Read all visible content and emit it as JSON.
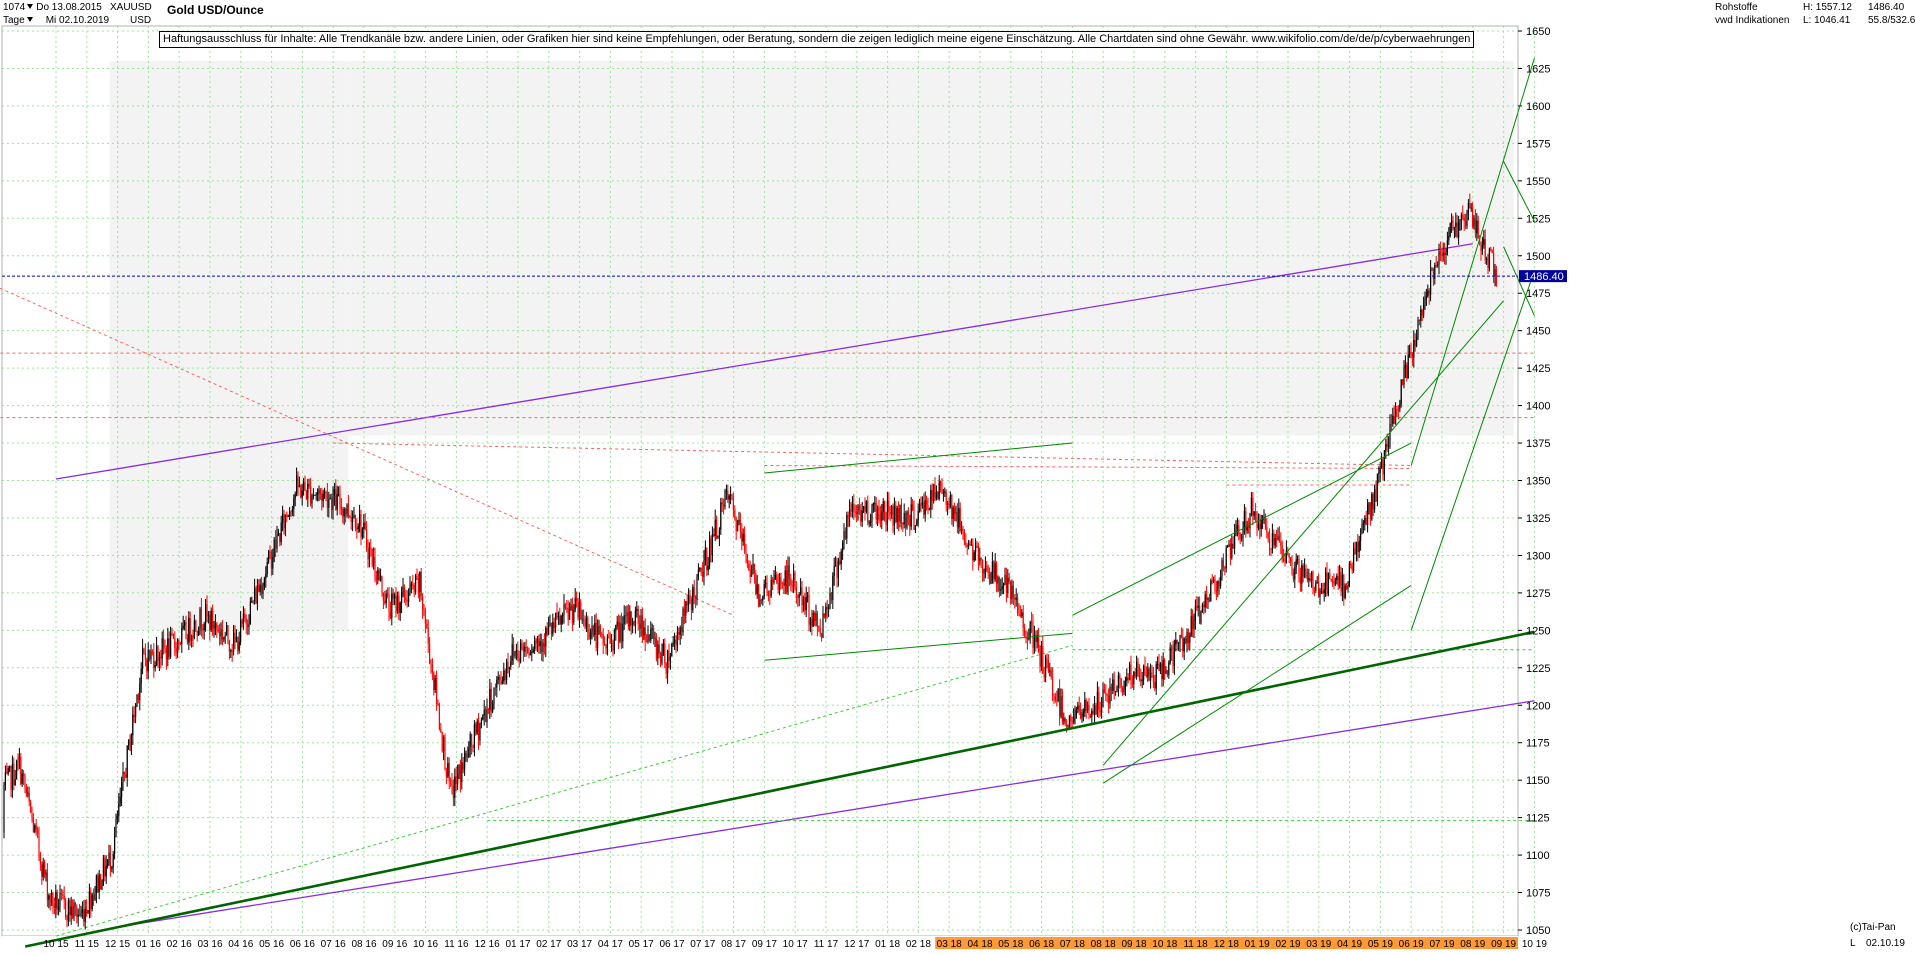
{
  "header": {
    "bar_count": "1074",
    "start_date": "Do 13.08.2015",
    "symbol": "XAUUSD",
    "period": "Tage",
    "end_date": "Mi 02.10.2019",
    "currency": "USD",
    "title": "Gold USD/Ounce",
    "category": "Rohstoffe",
    "source": "vwd Indikationen",
    "high_label": "H: 1557.12",
    "low_label": "L: 1046.41",
    "last_value": "1486.40",
    "range_value": "55.8/532.6",
    "copyright": "(c)Tai-Pan",
    "corner_marker": "L",
    "end_date_label": "02.10.19"
  },
  "disclaimer": "Haftungsausschluss für Inhalte: Alle Trendkanäle bzw. andere Linien, oder Grafiken hier sind keine Empfehlungen, oder Beratung, sondern die zeigen lediglich meine eigene Einschätzung. Alle Chartdaten sind ohne Gewähr.  www.wikifolio.com/de/de/p/cyberwaehrungen",
  "colors": {
    "up": "#000000",
    "down": "#ff0000",
    "grid": "#9be59b",
    "channel": "#008800",
    "support_dark": "#006400",
    "trend_purple": "#8a2be2",
    "dotted_red": "#ff6060",
    "last_price_line": "#0000cc",
    "last_price_box": "#0000a0",
    "timeline_highlight": "#ff9933",
    "shade": "#f3f3f3"
  },
  "chart_data": {
    "type": "candlestick",
    "instrument": "Gold USD/Ounce",
    "ylim": [
      1046,
      1656
    ],
    "y_ticks": [
      1050,
      1075,
      1100,
      1125,
      1150,
      1175,
      1200,
      1225,
      1250,
      1275,
      1300,
      1325,
      1350,
      1375,
      1400,
      1425,
      1450,
      1475,
      1500,
      1525,
      1550,
      1575,
      1600,
      1625,
      1650
    ],
    "x_ticks": [
      "10 15",
      "11 15",
      "12 15",
      "01 16",
      "02 16",
      "03 16",
      "04 16",
      "05 16",
      "06 16",
      "07 16",
      "08 16",
      "09 16",
      "10 16",
      "11 16",
      "12 16",
      "01 17",
      "02 17",
      "03 17",
      "04 17",
      "05 17",
      "06 17",
      "07 17",
      "08 17",
      "09 17",
      "10 17",
      "11 17",
      "12 17",
      "01 18",
      "02 18",
      "03 18",
      "04 18",
      "05 18",
      "06 18",
      "07 18",
      "08 18",
      "09 18",
      "10 18",
      "11 18",
      "12 18",
      "01 19",
      "02 19",
      "03 19",
      "04 19",
      "05 19",
      "06 19",
      "07 19",
      "08 19",
      "09 19",
      "10 19"
    ],
    "highlight_ticks_from": "03 18",
    "last_price": 1486.4,
    "high": 1557.12,
    "low": 1046.41,
    "price_path_monthly": [
      [
        "2015-08",
        1115
      ],
      [
        "2015-09",
        1130
      ],
      [
        "2015-10",
        1160
      ],
      [
        "2015-11",
        1070
      ],
      [
        "2015-12",
        1060
      ],
      [
        "2016-01",
        1100
      ],
      [
        "2016-02",
        1230
      ],
      [
        "2016-03",
        1240
      ],
      [
        "2016-04",
        1260
      ],
      [
        "2016-05",
        1240
      ],
      [
        "2016-06",
        1290
      ],
      [
        "2016-07",
        1345
      ],
      [
        "2016-08",
        1340
      ],
      [
        "2016-09",
        1325
      ],
      [
        "2016-10",
        1265
      ],
      [
        "2016-11",
        1280
      ],
      [
        "2016-12",
        1140
      ],
      [
        "2017-01",
        1190
      ],
      [
        "2017-02",
        1235
      ],
      [
        "2017-03",
        1245
      ],
      [
        "2017-04",
        1265
      ],
      [
        "2017-05",
        1240
      ],
      [
        "2017-06",
        1260
      ],
      [
        "2017-07",
        1230
      ],
      [
        "2017-08",
        1280
      ],
      [
        "2017-09",
        1340
      ],
      [
        "2017-10",
        1275
      ],
      [
        "2017-11",
        1285
      ],
      [
        "2017-12",
        1250
      ],
      [
        "2018-01",
        1330
      ],
      [
        "2018-02",
        1330
      ],
      [
        "2018-03",
        1325
      ],
      [
        "2018-04",
        1345
      ],
      [
        "2018-05",
        1300
      ],
      [
        "2018-06",
        1280
      ],
      [
        "2018-07",
        1240
      ],
      [
        "2018-08",
        1190
      ],
      [
        "2018-09",
        1200
      ],
      [
        "2018-10",
        1220
      ],
      [
        "2018-11",
        1220
      ],
      [
        "2018-12",
        1250
      ],
      [
        "2019-01",
        1290
      ],
      [
        "2019-02",
        1330
      ],
      [
        "2019-03",
        1300
      ],
      [
        "2019-04",
        1280
      ],
      [
        "2019-05",
        1280
      ],
      [
        "2019-06",
        1340
      ],
      [
        "2019-07",
        1420
      ],
      [
        "2019-08",
        1500
      ],
      [
        "2019-09",
        1530
      ],
      [
        "2019-10",
        1486
      ]
    ],
    "trendlines": [
      {
        "style": "purple",
        "from": [
          "2015-10",
          1351
        ],
        "to": [
          "2019-08",
          1508
        ]
      },
      {
        "style": "purple",
        "from": [
          "2015-12",
          1052
        ],
        "to": [
          "2019-10",
          1203
        ]
      },
      {
        "style": "dark-green-thick",
        "from": [
          "2015-09",
          1039
        ],
        "to": [
          "2019-10",
          1249
        ]
      },
      {
        "style": "green",
        "from": [
          "2017-09",
          1355
        ],
        "to": [
          "2018-07",
          1375
        ]
      },
      {
        "style": "green",
        "from": [
          "2017-09",
          1230
        ],
        "to": [
          "2018-07",
          1248
        ]
      },
      {
        "style": "green",
        "from": [
          "2018-07",
          1260
        ],
        "to": [
          "2019-06",
          1375
        ]
      },
      {
        "style": "green",
        "from": [
          "2018-08",
          1148
        ],
        "to": [
          "2019-06",
          1280
        ]
      },
      {
        "style": "green",
        "from": [
          "2018-08",
          1160
        ],
        "to": [
          "2019-09",
          1470
        ]
      },
      {
        "style": "green",
        "from": [
          "2019-06",
          1250
        ],
        "to": [
          "2019-10",
          1490
        ]
      },
      {
        "style": "green",
        "from": [
          "2019-06",
          1360
        ],
        "to": [
          "2019-10",
          1632
        ]
      },
      {
        "style": "green",
        "from": [
          "2019-09",
          1563
        ],
        "to": [
          "2019-10",
          1523
        ]
      },
      {
        "style": "green",
        "from": [
          "2019-09",
          1506
        ],
        "to": [
          "2019-10",
          1460
        ]
      },
      {
        "style": "green-dotted",
        "from": [
          "2015-10",
          1046
        ],
        "to": [
          "2018-07",
          1240
        ]
      },
      {
        "style": "green-dotted",
        "from": [
          "2016-12",
          1123
        ],
        "to": [
          "2019-10",
          1123
        ]
      },
      {
        "style": "green-dotted",
        "from": [
          "2018-07",
          1237
        ],
        "to": [
          "2019-10",
          1237
        ]
      },
      {
        "style": "red-dotted",
        "from": [
          "2015-08",
          1480
        ],
        "to": [
          "2017-08",
          1260
        ]
      },
      {
        "style": "red-dotted",
        "from": [
          "2016-07",
          1375
        ],
        "to": [
          "2019-06",
          1360
        ]
      },
      {
        "style": "red-dotted",
        "from": [
          "2015-08",
          1435
        ],
        "to": [
          "2019-10",
          1435
        ]
      },
      {
        "style": "red-dotted",
        "from": [
          "2015-08",
          1392
        ],
        "to": [
          "2019-10",
          1392
        ]
      },
      {
        "style": "red-dotted",
        "from": [
          "2017-09",
          1360
        ],
        "to": [
          "2019-06",
          1358
        ]
      },
      {
        "style": "red-dotted",
        "from": [
          "2018-12",
          1347
        ],
        "to": [
          "2019-06",
          1347
        ]
      }
    ]
  }
}
